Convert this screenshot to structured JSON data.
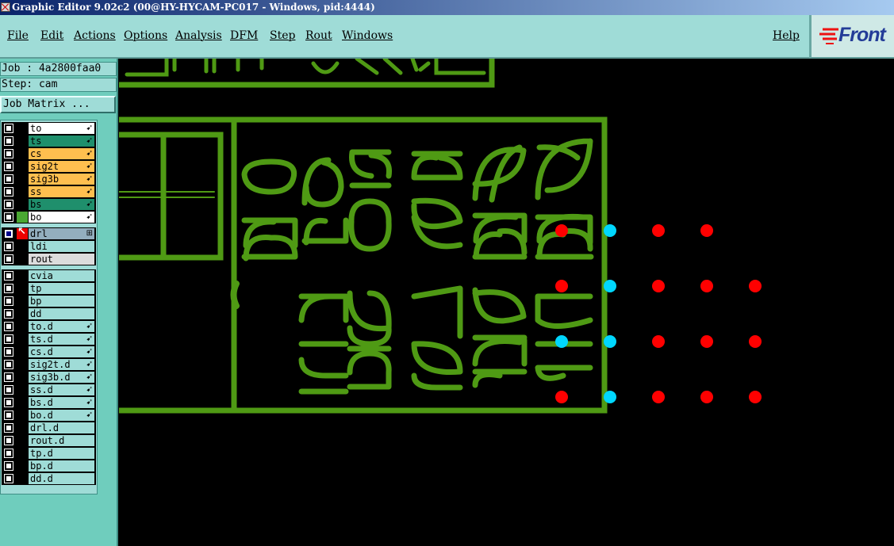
{
  "window": {
    "title": "Graphic Editor 9.02c2 (00@HY-HYCAM-PC017 - Windows, pid:4444)"
  },
  "menu": {
    "items": [
      {
        "id": "file",
        "label": "File"
      },
      {
        "id": "edit",
        "label": "Edit"
      },
      {
        "id": "actions",
        "label": "Actions"
      },
      {
        "id": "options",
        "label": "Options"
      },
      {
        "id": "analysis",
        "label": "Analysis"
      },
      {
        "id": "dfm",
        "label": "DFM"
      },
      {
        "id": "step",
        "label": "Step"
      },
      {
        "id": "rout",
        "label": "Rout"
      },
      {
        "id": "windows",
        "label": "Windows"
      }
    ],
    "help_label": "Help"
  },
  "logo": {
    "text": "Front"
  },
  "sidebar": {
    "job_label": "Job : 4a2800faa0",
    "step_label": "Step: cam",
    "job_matrix_button": "Job Matrix ..."
  },
  "layers": {
    "signal": [
      {
        "name": "to",
        "color": "#ffffff",
        "flag": "➹"
      },
      {
        "name": "ts",
        "color": "#1f8f6c",
        "flag": "➹"
      },
      {
        "name": "cs",
        "color": "#ffbf4f",
        "flag": "➹"
      },
      {
        "name": "sig2t",
        "color": "#ffbf4f",
        "flag": "➹"
      },
      {
        "name": "sig3b",
        "color": "#ffbf4f",
        "flag": "➹"
      },
      {
        "name": "ss",
        "color": "#ffbf4f",
        "flag": "➹"
      },
      {
        "name": "bs",
        "color": "#1f8f6c",
        "flag": "➹"
      },
      {
        "name": "bo",
        "color": "#ffffff",
        "flag": "➹"
      }
    ],
    "drill": [
      {
        "name": "drl",
        "color": "#93aebe",
        "flag": "⊞",
        "active": true
      },
      {
        "name": "ldi",
        "color": "#9fdcd7",
        "flag": ""
      },
      {
        "name": "rout",
        "color": "#dcdcdc",
        "flag": ""
      }
    ],
    "misc": [
      {
        "name": "cvia",
        "flag": ""
      },
      {
        "name": "tp",
        "flag": ""
      },
      {
        "name": "bp",
        "flag": ""
      },
      {
        "name": "dd",
        "flag": ""
      },
      {
        "name": "to.d",
        "flag": "➹"
      },
      {
        "name": "ts.d",
        "flag": "➹"
      },
      {
        "name": "cs.d",
        "flag": "➹"
      },
      {
        "name": "sig2t.d",
        "flag": "➹"
      },
      {
        "name": "sig3b.d",
        "flag": "➹"
      },
      {
        "name": "ss.d",
        "flag": "➹"
      },
      {
        "name": "bs.d",
        "flag": "➹"
      },
      {
        "name": "bo.d",
        "flag": "➹"
      },
      {
        "name": "drl.d",
        "flag": ""
      },
      {
        "name": "rout.d",
        "flag": ""
      },
      {
        "name": "tp.d",
        "flag": ""
      },
      {
        "name": "bp.d",
        "flag": ""
      },
      {
        "name": "dd.d",
        "flag": ""
      }
    ]
  },
  "canvas": {
    "colors": {
      "board_outline": "#4f9a14",
      "drill_red": "#ff0000",
      "drill_cyan": "#00d7ff"
    },
    "silkscreen_texts": [
      {
        "text": "C2"
      },
      {
        "text": "C25"
      },
      {
        "text": "C52"
      },
      {
        "text": "R36"
      },
      {
        "text": "R29"
      },
      {
        "text": "C28"
      },
      {
        "text": "C25"
      },
      {
        "text": "C27"
      },
      {
        "text": "C28"
      },
      {
        "text": "R25"
      }
    ]
  }
}
